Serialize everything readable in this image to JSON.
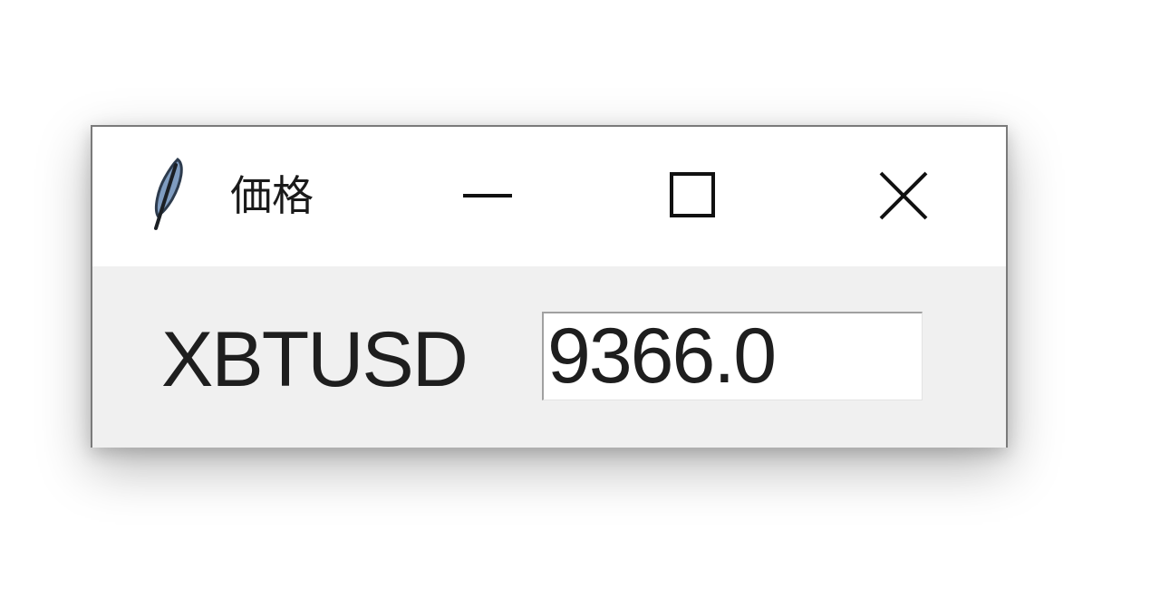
{
  "window": {
    "title": "価格",
    "controls": {
      "minimize": "minimize-icon",
      "maximize": "maximize-icon",
      "close": "close-icon"
    }
  },
  "content": {
    "symbol_label": "XBTUSD",
    "price_value": "9366.0"
  },
  "colors": {
    "client_background": "#f0f0f0",
    "titlebar_background": "#ffffff",
    "text": "#1e1e1e",
    "entry_background": "#ffffff"
  }
}
